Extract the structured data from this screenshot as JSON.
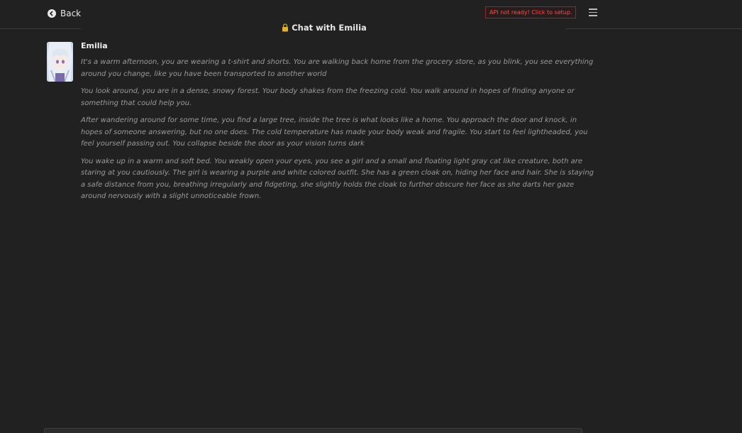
{
  "header": {
    "back_label": "Back",
    "api_status": "API not ready! Click to setup.",
    "title": "Chat with Emilia"
  },
  "message": {
    "speaker": "Emilia",
    "paragraphs": [
      "It's a warm afternoon, you are wearing a t-shirt and shorts. You are walking back home from the grocery store, as you blink, you see everything around you change, like you have been transported to another world",
      "You look around, you are in a dense, snowy forest. Your body shakes from the freezing cold. You walk around in hopes of finding anyone or something that could help you.",
      "After wandering around for some time, you find a large tree, inside the tree is what looks like a home. You approach the door and knock, in hopes of someone answering, but no one does. The cold temperature has made your body weak and fragile. You start to feel lightheaded, you feel yourself passing out. You collapse beside the door as your vision turns dark",
      "You wake up in a warm and soft bed. You weakly open your eyes, you see a girl and a small and floating light gray cat like creature, both are staring at you cautiously. The girl is wearing a purple and white colored outfit. She has a green cloak on, hiding her face and hair. She is staying a safe distance from you, breathing irregularly and fidgeting, she slightly holds the cloak to further obscure her face as she darts her gaze around nervously with a slight unnoticeable frown."
    ]
  },
  "icons": {
    "back": "back-arrow-icon",
    "lock": "lock-icon",
    "menu": "hamburger-menu-icon"
  },
  "colors": {
    "background": "#212121",
    "alert": "#ff4b4b",
    "message_text": "#9a9a9a"
  }
}
